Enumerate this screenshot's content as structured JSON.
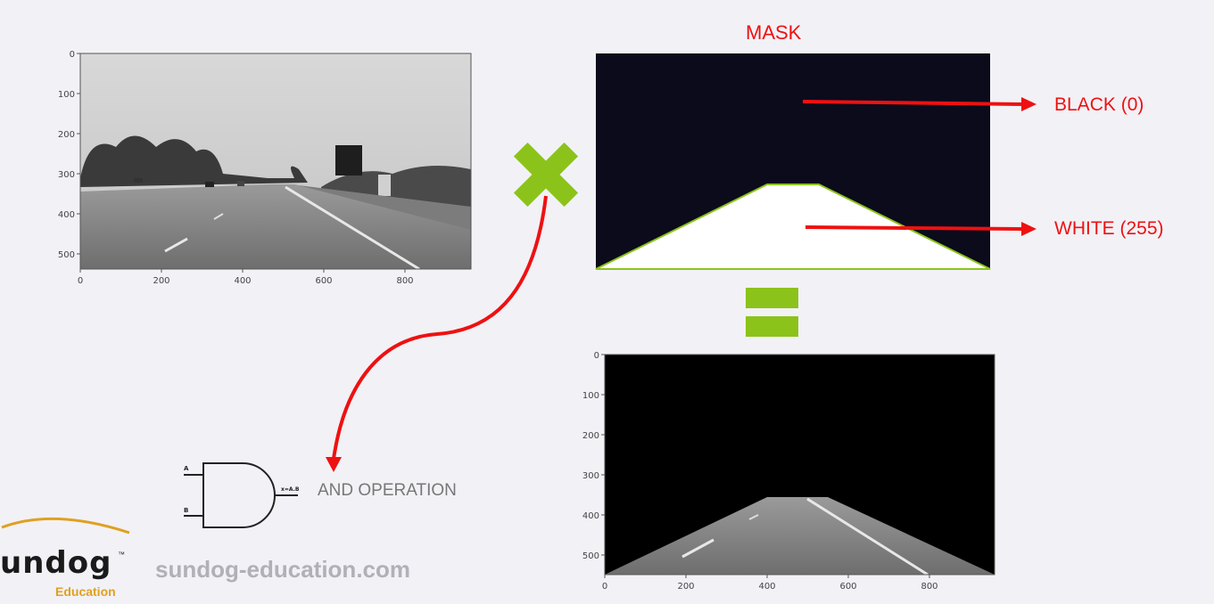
{
  "mask": {
    "title": "MASK",
    "black_label": "BLACK (0)",
    "white_label": "WHITE (255)"
  },
  "gate": {
    "label": "AND OPERATION",
    "input_a": "A",
    "input_b": "B",
    "output": "x=A.B"
  },
  "branding": {
    "name": "undog",
    "tm": "™",
    "sub": "Education",
    "url": "sundog-education.com"
  },
  "plot1": {
    "y_ticks": [
      "0",
      "100",
      "200",
      "300",
      "400",
      "500"
    ],
    "x_ticks": [
      "0",
      "200",
      "400",
      "600",
      "800"
    ]
  },
  "plot2": {
    "y_ticks": [
      "0",
      "100",
      "200",
      "300",
      "400",
      "500"
    ],
    "x_ticks": [
      "0",
      "200",
      "400",
      "600",
      "800"
    ]
  },
  "colors": {
    "accent_red": "#ee1111",
    "accent_green": "#8cc31a",
    "mask_black": "#0b0b1c",
    "background": "#f2f1f6"
  }
}
